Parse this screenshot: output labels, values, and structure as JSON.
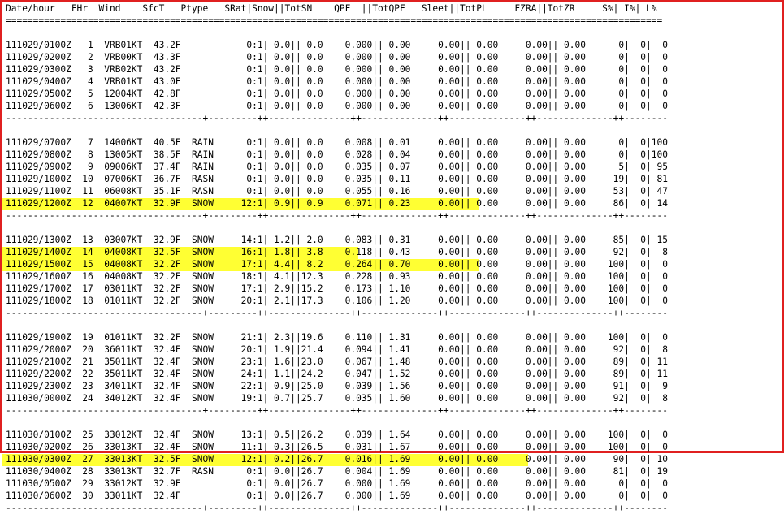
{
  "header": "Date/hour   FHr  Wind    SfcT   Ptype   SRat|Snow||TotSN    QPF  ||TotQPF   Sleet||TotPL     FZRA||TotZR     S%| I%| L%",
  "sep_top": "========================================================================================================================",
  "sep_blk": "------------------------------------+---------++---------------++--------------++--------------++--------------++--------",
  "blocks": [
    [
      "111029/0100Z   1  VRB01KT  43.2F            0:1| 0.0|| 0.0    0.000|| 0.00     0.00|| 0.00     0.00|| 0.00      0|  0|  0",
      "111029/0200Z   2  VRB00KT  43.3F            0:1| 0.0|| 0.0    0.000|| 0.00     0.00|| 0.00     0.00|| 0.00      0|  0|  0",
      "111029/0300Z   3  VRB02KT  43.2F            0:1| 0.0|| 0.0    0.000|| 0.00     0.00|| 0.00     0.00|| 0.00      0|  0|  0",
      "111029/0400Z   4  VRB01KT  43.0F            0:1| 0.0|| 0.0    0.000|| 0.00     0.00|| 0.00     0.00|| 0.00      0|  0|  0",
      "111029/0500Z   5  12004KT  42.8F            0:1| 0.0|| 0.0    0.000|| 0.00     0.00|| 0.00     0.00|| 0.00      0|  0|  0",
      "111029/0600Z   6  13006KT  42.3F            0:1| 0.0|| 0.0    0.000|| 0.00     0.00|| 0.00     0.00|| 0.00      0|  0|  0"
    ],
    [
      "111029/0700Z   7  14006KT  40.5F  RAIN      0:1| 0.0|| 0.0    0.008|| 0.01     0.00|| 0.00     0.00|| 0.00      0|  0|100",
      "111029/0800Z   8  13005KT  38.5F  RAIN      0:1| 0.0|| 0.0    0.028|| 0.04     0.00|| 0.00     0.00|| 0.00      0|  0|100",
      "111029/0900Z   9  09006KT  37.4F  RAIN      0:1| 0.0|| 0.0    0.035|| 0.07     0.00|| 0.00     0.00|| 0.00      5|  0| 95",
      "111029/1000Z  10  07006KT  36.7F  RASN      0:1| 0.0|| 0.0    0.035|| 0.11     0.00|| 0.00     0.00|| 0.00     19|  0| 81",
      "111029/1100Z  11  06008KT  35.1F  RASN      0:1| 0.0|| 0.0    0.055|| 0.16     0.00|| 0.00     0.00|| 0.00     53|  0| 47",
      "111029/1200Z  12  04007KT  32.9F  SNOW     12:1| 0.9|| 0.9    0.071|| 0.23     0.00|| 0.00     0.00|| 0.00     86|  0| 14"
    ],
    [
      "111029/1300Z  13  03007KT  32.9F  SNOW     14:1| 1.2|| 2.0    0.083|| 0.31     0.00|| 0.00     0.00|| 0.00     85|  0| 15",
      "111029/1400Z  14  04008KT  32.5F  SNOW     16:1| 1.8|| 3.8    0.118|| 0.43     0.00|| 0.00     0.00|| 0.00     92|  0|  8",
      "111029/1500Z  15  04008KT  32.2F  SNOW     17:1| 4.4|| 8.2    0.264|| 0.70     0.00|| 0.00     0.00|| 0.00    100|  0|  0",
      "111029/1600Z  16  04008KT  32.2F  SNOW     18:1| 4.1||12.3    0.228|| 0.93     0.00|| 0.00     0.00|| 0.00    100|  0|  0",
      "111029/1700Z  17  03011KT  32.2F  SNOW     17:1| 2.9||15.2    0.173|| 1.10     0.00|| 0.00     0.00|| 0.00    100|  0|  0",
      "111029/1800Z  18  01011KT  32.2F  SNOW     20:1| 2.1||17.3    0.106|| 1.20     0.00|| 0.00     0.00|| 0.00    100|  0|  0"
    ],
    [
      "111029/1900Z  19  01011KT  32.2F  SNOW     21:1| 2.3||19.6    0.110|| 1.31     0.00|| 0.00     0.00|| 0.00    100|  0|  0",
      "111029/2000Z  20  36011KT  32.4F  SNOW     20:1| 1.9||21.4    0.094|| 1.41     0.00|| 0.00     0.00|| 0.00     92|  0|  8",
      "111029/2100Z  21  35011KT  32.4F  SNOW     23:1| 1.6||23.0    0.067|| 1.48     0.00|| 0.00     0.00|| 0.00     89|  0| 11",
      "111029/2200Z  22  35011KT  32.4F  SNOW     24:1| 1.1||24.2    0.047|| 1.52     0.00|| 0.00     0.00|| 0.00     89|  0| 11",
      "111029/2300Z  23  34011KT  32.4F  SNOW     22:1| 0.9||25.0    0.039|| 1.56     0.00|| 0.00     0.00|| 0.00     91|  0|  9",
      "111030/0000Z  24  34012KT  32.4F  SNOW     19:1| 0.7||25.7    0.035|| 1.60     0.00|| 0.00     0.00|| 0.00     92|  0|  8"
    ],
    [
      "111030/0100Z  25  33012KT  32.4F  SNOW     13:1| 0.5||26.2    0.039|| 1.64     0.00|| 0.00     0.00|| 0.00    100|  0|  0",
      "111030/0200Z  26  33013KT  32.4F  SNOW     11:1| 0.3||26.5    0.031|| 1.67     0.00|| 0.00     0.00|| 0.00    100|  0|  0",
      "111030/0300Z  27  33013KT  32.5F  SNOW     12:1| 0.2||26.7    0.016|| 1.69     0.00|| 0.00     0.00|| 0.00     90|  0| 10",
      "111030/0400Z  28  33013KT  32.7F  RASN      0:1| 0.0||26.7    0.004|| 1.69     0.00|| 0.00     0.00|| 0.00     81|  0| 19",
      "111030/0500Z  29  33012KT  32.9F            0:1| 0.0||26.7    0.000|| 1.69     0.00|| 0.00     0.00|| 0.00      0|  0|  0",
      "111030/0600Z  30  33011KT  32.4F            0:1| 0.0||26.7    0.000|| 1.69     0.00|| 0.00     0.00|| 0.00      0|  0|  0"
    ]
  ],
  "highlights": [
    {
      "block": 1,
      "row": 5,
      "cols": 86
    },
    {
      "block": 2,
      "row": 1,
      "cols": 64
    },
    {
      "block": 2,
      "row": 2,
      "cols": 86
    },
    {
      "block": 4,
      "row": 2,
      "cols": 95
    }
  ],
  "colors": {
    "frame_border": "#e02020",
    "highlight": "#ffff33"
  }
}
